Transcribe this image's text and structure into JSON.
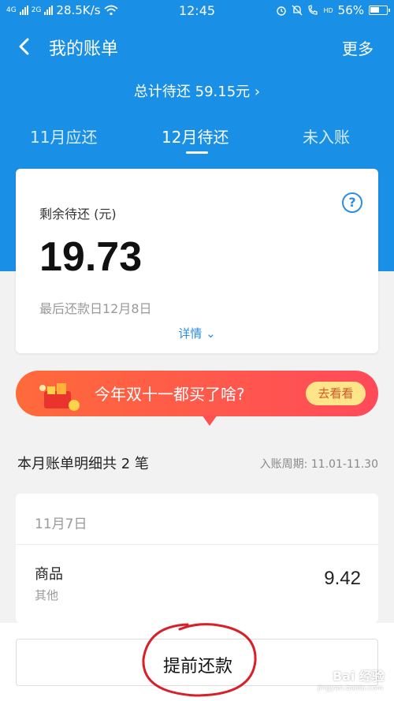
{
  "status_bar": {
    "signal_left": "4G",
    "signal_right": "2G",
    "speed": "28.5K/s",
    "time": "12:45",
    "hd": "HD",
    "battery": "56%"
  },
  "header": {
    "title": "我的账单",
    "more": "更多",
    "total": "总计待还 59.15元 ›"
  },
  "tabs": [
    {
      "label": "11月应还"
    },
    {
      "label": "12月待还"
    },
    {
      "label": "未入账"
    }
  ],
  "card": {
    "label": "剩余待还 (元)",
    "help": "?",
    "amount": "19.73",
    "due": "最后还款日12月8日",
    "detail": "详情 ⌄"
  },
  "banner": {
    "text": "今年双十一都买了啥?",
    "button": "去看看"
  },
  "bill": {
    "title": "本月账单明细共 2 笔",
    "period": "入账周期: 11.01-11.30",
    "date": "11月7日",
    "item_name": "商品",
    "item_category": "其他",
    "item_amount": "9.42"
  },
  "bottom": {
    "repay_label": "提前还款"
  },
  "watermark": {
    "text": "Bai 经验",
    "sub": "jingyan.baidu.com"
  },
  "colors": {
    "primary": "#1a8fe6",
    "link": "#2b8ee0",
    "banner_start": "#ff6a3a",
    "banner_end": "#ff4a5a",
    "annotation": "#d8202a"
  }
}
